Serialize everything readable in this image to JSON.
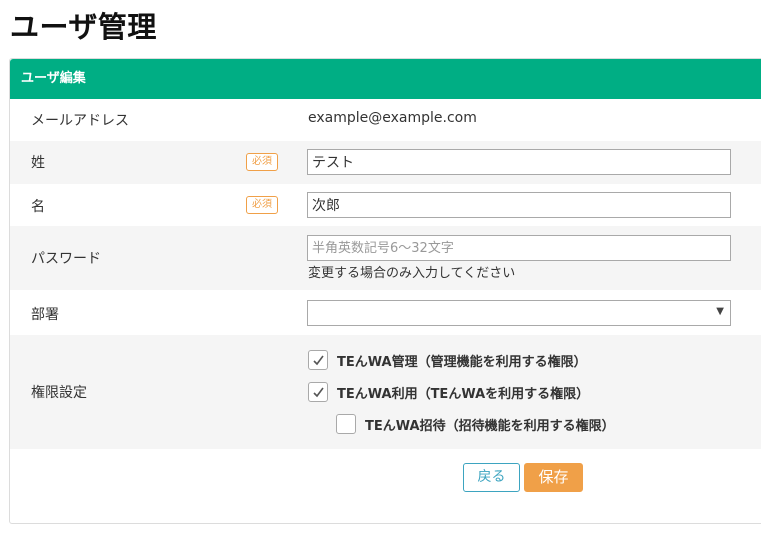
{
  "page": {
    "title": "ユーザ管理"
  },
  "panel": {
    "header": "ユーザ編集"
  },
  "form": {
    "email": {
      "label": "メールアドレス",
      "value": "example@example.com"
    },
    "last_name": {
      "label": "姓",
      "required_badge": "必須",
      "value": "テスト"
    },
    "first_name": {
      "label": "名",
      "required_badge": "必須",
      "value": "次郎"
    },
    "password": {
      "label": "パスワード",
      "placeholder": "半角英数記号6～32文字",
      "hint": "変更する場合のみ入力してください"
    },
    "department": {
      "label": "部署",
      "selected": ""
    },
    "permissions": {
      "label": "権限設定",
      "items": [
        {
          "label": "TEんWA管理（管理機能を利用する権限）",
          "checked": true
        },
        {
          "label": "TEんWA利用（TEんWAを利用する権限）",
          "checked": true
        },
        {
          "label": "TEんWA招待（招待機能を利用する権限）",
          "checked": false
        }
      ]
    }
  },
  "buttons": {
    "back": "戻る",
    "save": "保存"
  },
  "colors": {
    "header_bg": "#00ae84",
    "accent_orange": "#f0a048",
    "accent_blue": "#3da4c0"
  },
  "icons": {
    "checkmark": "check-icon",
    "dropdown": "triangle-down-icon"
  }
}
